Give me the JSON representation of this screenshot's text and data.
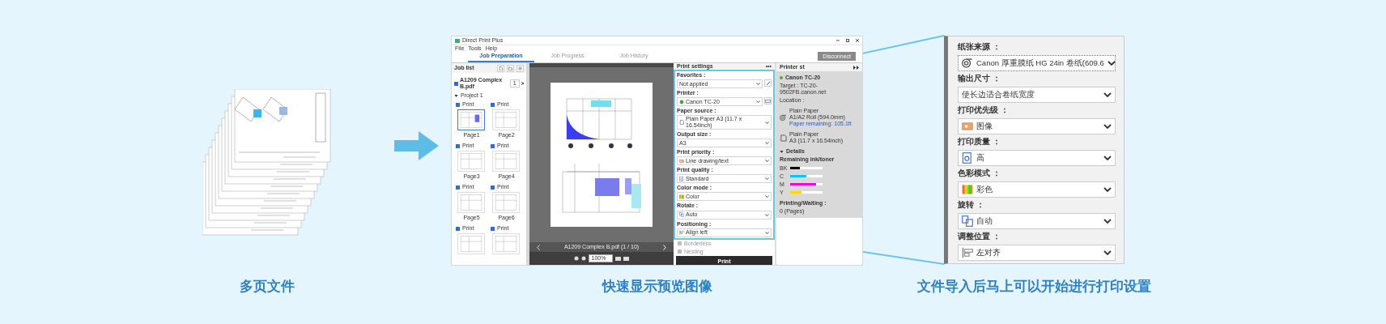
{
  "app": {
    "title": "Direct Print Plus",
    "menu": [
      "File",
      "Tools",
      "Help"
    ],
    "tabs": [
      {
        "label": "Job Preparation",
        "selected": true
      },
      {
        "label": "Job Progress",
        "selected": false
      },
      {
        "label": "Job History",
        "selected": false
      }
    ],
    "disconnect": "Disconnect",
    "job_list": {
      "title": "Job list",
      "file": {
        "name": "A1209 Complex B.pdf",
        "checked": true,
        "copies": "1"
      },
      "group": "Project 1",
      "expanded": true,
      "pages": [
        {
          "check": "Print",
          "checked": true,
          "label": "Page1",
          "selected": true
        },
        {
          "check": "Print",
          "checked": true,
          "label": "Page2",
          "selected": false
        },
        {
          "check": "Print",
          "checked": true,
          "label": "Page3",
          "selected": false
        },
        {
          "check": "Print",
          "checked": true,
          "label": "Page4",
          "selected": false
        },
        {
          "check": "Print",
          "checked": true,
          "label": "Page5",
          "selected": false
        },
        {
          "check": "Print",
          "checked": true,
          "label": "Page6",
          "selected": false
        },
        {
          "check": "Print",
          "checked": true,
          "selected": false
        },
        {
          "check": "Print",
          "checked": true,
          "selected": false
        }
      ]
    },
    "preview": {
      "file": "A1209 Complex B.pdf (1 / 10)",
      "zoom": "100%"
    },
    "print_settings": {
      "title": "Print settings",
      "more": "•••",
      "fields": [
        {
          "label": "Favorites :",
          "value": "Not applied",
          "kind": "plain"
        },
        {
          "label": "Printer :",
          "value": "Canon TC-20",
          "kind": "dot"
        },
        {
          "label": "Paper source :",
          "value": "Plain Paper A3 (11.7 x 16.54inch)",
          "kind": "sheet"
        },
        {
          "label": "Output size :",
          "value": "A3",
          "kind": "plain"
        },
        {
          "label": "Print priority :",
          "value": "Line drawing/text",
          "kind": "priority"
        },
        {
          "label": "Print quality :",
          "value": "Standard",
          "kind": "quality"
        },
        {
          "label": "Color mode :",
          "value": "Color",
          "kind": "color"
        },
        {
          "label": "Rotate :",
          "value": "Auto",
          "kind": "rotate"
        },
        {
          "label": "Positioning :",
          "value": "Align left",
          "kind": "position"
        }
      ],
      "options": [
        {
          "label": "Borderless",
          "disabled": true
        },
        {
          "label": "Nesting",
          "disabled": true
        }
      ],
      "print_button": "Print"
    },
    "printer_status": {
      "title": "Printer st",
      "printer": "Canon TC-20",
      "target": "Target : TC-20-9502FB.canon.net",
      "location": "Location :",
      "papers": [
        {
          "kind": "roll",
          "name": "Plain Paper",
          "size": "A1/A2 Roll (594.0mm)",
          "remaining": "Paper remaining: 105.1ft"
        },
        {
          "kind": "sheet",
          "name": "Plain Paper",
          "size": "A3 (11.7 x 16.54inch)"
        }
      ],
      "details": "Details",
      "details_expanded": true,
      "ink_title": "Remaining ink/toner",
      "inks": [
        {
          "name": "BK",
          "color": "#000000",
          "level": 0.3
        },
        {
          "name": "C",
          "color": "#00c8f0",
          "level": 0.5
        },
        {
          "name": "M",
          "color": "#f000e0",
          "level": 0.8
        },
        {
          "name": "Y",
          "color": "#ffd800",
          "level": 0.35
        }
      ],
      "waiting_label": "Printing/Waiting :",
      "waiting": "0 (Pages)"
    }
  },
  "zoom_panel": {
    "fields": [
      {
        "label": "纸张来源 ：",
        "value": "Canon 厚重膜纸 HG 24in 卷纸(609.6",
        "kind": "roll",
        "focused": true
      },
      {
        "label": "输出尺寸 ：",
        "value": "使长边适合卷纸宽度",
        "kind": "plain",
        "focused": false
      },
      {
        "label": "打印优先级 ：",
        "value": "图像",
        "kind": "priority",
        "focused": false
      },
      {
        "label": "打印质量 ：",
        "value": "高",
        "kind": "quality",
        "focused": false
      },
      {
        "label": "色彩模式 ：",
        "value": "彩色",
        "kind": "color",
        "focused": false
      },
      {
        "label": "旋转 ：",
        "value": "自动",
        "kind": "rotate",
        "focused": false
      },
      {
        "label": "调整位置 ：",
        "value": "左对齐",
        "kind": "position",
        "focused": false
      }
    ]
  },
  "captions": [
    "多页文件",
    "快速显示预览图像",
    "文件导入后马上可以开始进行打印设置"
  ]
}
